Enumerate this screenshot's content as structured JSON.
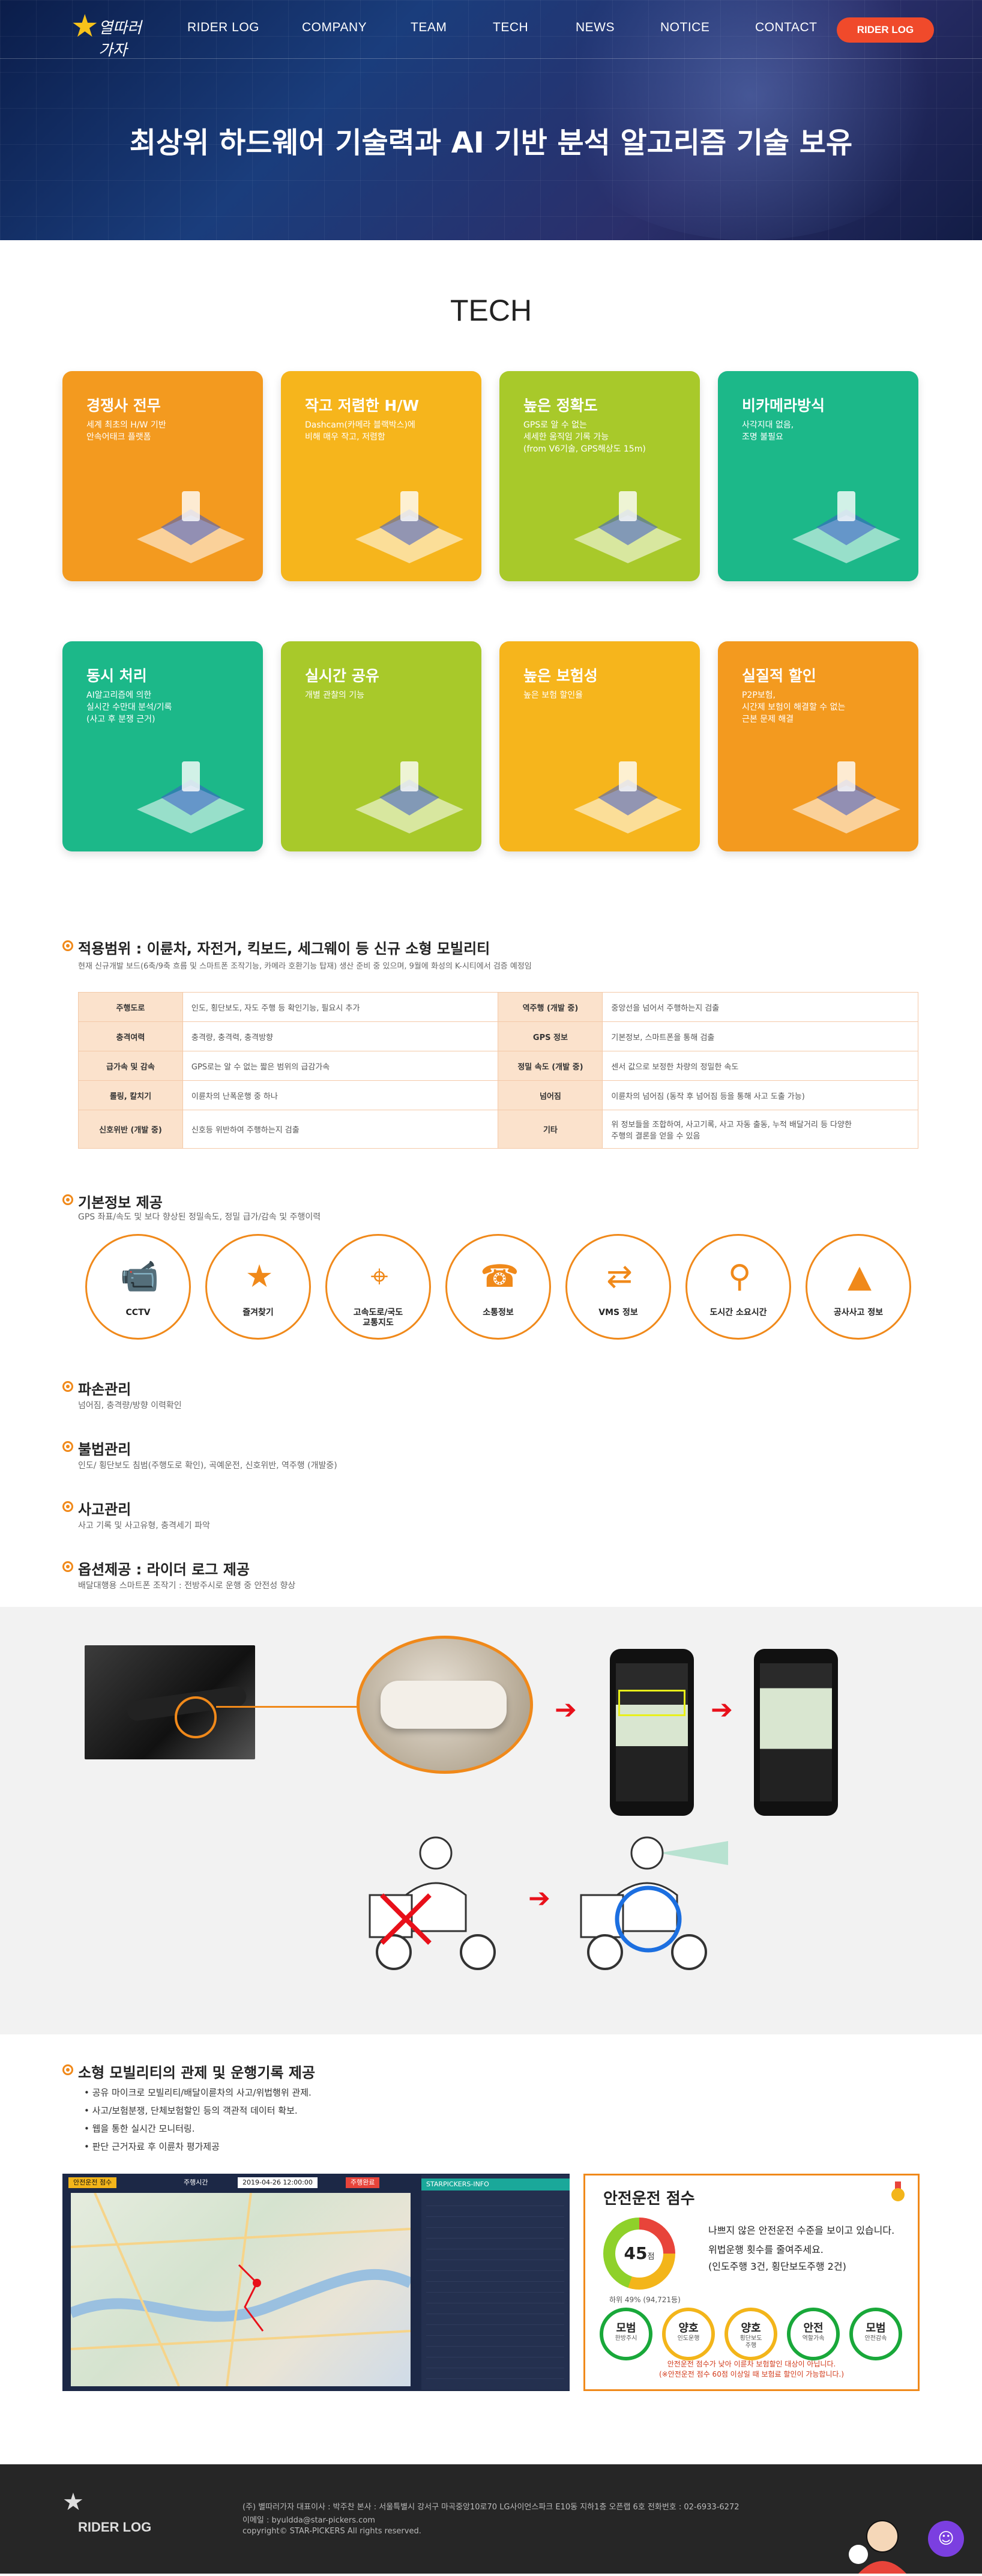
{
  "nav": {
    "logo_text": "열따러가자",
    "items": [
      "RIDER LOG",
      "COMPANY",
      "TEAM",
      "TECH",
      "NEWS",
      "NOTICE",
      "CONTACT"
    ],
    "button": "RIDER LOG"
  },
  "hero": {
    "title": "최상위 하드웨어 기술력과 AI 기반 분석 알고리즘 기술 보유"
  },
  "tech": {
    "title": "TECH",
    "cards": [
      {
        "title": "경쟁사 전무",
        "desc": "세계 최초의 H/W 기반\n안속어태크 플랫폼",
        "color": "#f39a1f"
      },
      {
        "title": "작고 저렴한 H/W",
        "desc": "Dashcam(카메라 블랙박스)에\n비해 매우 작고, 저렴함",
        "color": "#f6b51c"
      },
      {
        "title": "높은 정확도",
        "desc": "GPS로 알 수 없는\n세세한 움직임 기록 가능\n(from V6기술, GPS해상도 15m)",
        "color": "#a8c92a"
      },
      {
        "title": "비카메라방식",
        "desc": "사각지대 없음,\n조명 불필요",
        "color": "#1cb889"
      },
      {
        "title": "동시 처리",
        "desc": "AI알고리즘에 의한\n실시간 수만대 분석/기록\n(사고 후 분쟁 근거)",
        "color": "#1cb889"
      },
      {
        "title": "실시간 공유",
        "desc": "개별 관찰의 기능",
        "color": "#a8c92a"
      },
      {
        "title": "높은 보험성",
        "desc": "높은 보험 할인율",
        "color": "#f6b51c"
      },
      {
        "title": "실질적 할인",
        "desc": "P2P보험,\n시간제 보험이 해결할 수 없는\n근본 문제 해결",
        "color": "#f39a1f"
      }
    ]
  },
  "scope": {
    "title": "적용범위 : 이륜차, 자전거, 킥보드, 세그웨이 등 신규 소형 모빌리티",
    "subtitle": "현재 신규개발 보드(6축/9축 흐름 및 스마트폰 조작기능, 카메라 호환기능 탑재) 생산 준비 중 있으며, 9월에 화성의 K-시티에서 검증 예정임",
    "rows": [
      [
        "주행도로",
        "인도, 횡단보도, 자도 주행 등 확인기능, 필요시 추가",
        "역주행 (개발 중)",
        "중앙선을 넘어서 주행하는지 검출"
      ],
      [
        "충격여력",
        "충격량, 충격력, 충격방향",
        "GPS 정보",
        "기본정보, 스마트폰을 통해 검출"
      ],
      [
        "급가속 및 감속",
        "GPS로는 알 수 없는 짧은 범위의 급감가속",
        "정밀 속도 (개발 중)",
        "센서 값으로 보정한 차량의 정밀한 속도"
      ],
      [
        "롤링, 칼치기",
        "이륜차의 난폭운행 중 하나",
        "넘어짐",
        "이륜차의 넘어짐 (동작 후 넘어짐 등을 통해 사고 도출 가능)"
      ],
      [
        "신호위반 (개발 중)",
        "신호등 위반하여 주행하는지 검출",
        "기타",
        "위 정보들을 조합하여, 사고기록, 사고 자동 출동, 누적 배달거리 등 다양한\n주행의 결론을 얻을 수 있음"
      ]
    ]
  },
  "basic": {
    "title": "기본정보 제공",
    "subtitle": "GPS 좌표/속도 및 보다 향상된 정밀속도, 정밀 급가/감속 및 주행이력",
    "items": [
      {
        "label": "CCTV",
        "icon": "cctv-icon"
      },
      {
        "label": "즐겨찾기",
        "icon": "favorite-icon"
      },
      {
        "label": "고속도로/국도\n교통지도",
        "icon": "map-pin-icon"
      },
      {
        "label": "소통정보",
        "icon": "traffic-phone-icon"
      },
      {
        "label": "VMS 정보",
        "icon": "signpost-icon"
      },
      {
        "label": "도시간 소요시간",
        "icon": "route-icon"
      },
      {
        "label": "공사사고 정보",
        "icon": "cone-icon"
      }
    ]
  },
  "sections": [
    {
      "title": "파손관리",
      "subtitle": "넘어짐, 충격량/방향 이력확인"
    },
    {
      "title": "불법관리",
      "subtitle": "인도/ 횡단보도 침범(주행도로 확인), 곡예운전, 신호위반, 역주행 (개발중)"
    },
    {
      "title": "사고관리",
      "subtitle": "사고 기록 및 사고유형, 충격세기 파악"
    },
    {
      "title": "옵션제공 : 라이더 로그 제공",
      "subtitle": "배달대행용 스마트폰 조작기 : 전방주시로 운행 중 안전성 향상"
    }
  ],
  "control": {
    "title": "소형 모빌리티의 관제 및 운행기록 제공",
    "items": [
      "공유 마이크로 모빌리티/배달이륜차의 사고/위법행위 관제.",
      "사고/보험분쟁, 단체보험할인 등의 객관적 데이터 확보.",
      "웹을 통한 실시간 모니터링.",
      "판단 근거자료 후 이륜차 평가제공"
    ]
  },
  "map": {
    "topbar": [
      "안전운전 점수",
      "주행시간",
      "2019-04-26 12:00:00",
      "주행완료"
    ],
    "panel_title": "STARPICKERS-INFO"
  },
  "score": {
    "title": "안전운전 점수",
    "value": "45",
    "unit": "점",
    "sub": "하위 49% (94,721등)",
    "lines": [
      "나쁘지 않은 안전운전 수준을 보이고 있습니다.",
      "위법운행 횟수를 줄여주세요.",
      "(인도주행 3건, 횡단보도주행 2건)"
    ],
    "badges": [
      {
        "t": "모범",
        "s": "한방주시",
        "c": "#19a83a"
      },
      {
        "t": "양호",
        "s": "인도운행",
        "c": "#f3b51a"
      },
      {
        "t": "양호",
        "s": "횡단보도\n주행",
        "c": "#f3b51a"
      },
      {
        "t": "안전",
        "s": "역할가속",
        "c": "#19a83a"
      },
      {
        "t": "모범",
        "s": "안전감속",
        "c": "#19a83a"
      }
    ],
    "note": "안전운전 점수가 낮아 이륜차 보험할인 대상이 아닙니다.\n(※안전운전 점수 60점 이상일 때 보험료 할인이 가능합니다.)"
  },
  "footer": {
    "logo": "RIDER LOG",
    "line1": "(주) 별따러가자    대표이사 : 박주찬    본사 : 서울특별시 강서구 마곡중앙10로70 LG사이언스파크 E10동 지하1층 오픈랩 6호    전화번호 : 02-6933-6272",
    "line2": "이메일 : byuldda@star-pickers.com",
    "line3": "copyright© STAR-PICKERS All rights reserved."
  },
  "colors": {
    "accent": "#f0891a",
    "nav_button": "#f04a2b",
    "footer_bg": "#262626"
  }
}
